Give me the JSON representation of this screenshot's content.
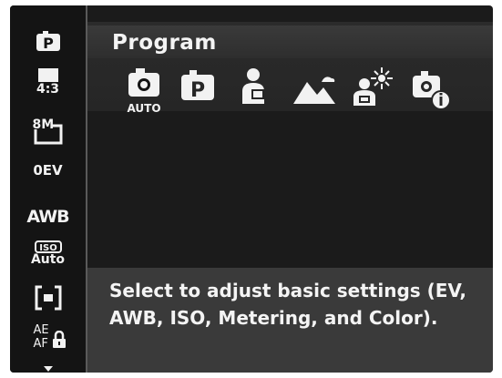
{
  "sidebar": {
    "items": [
      {
        "icon": "program-mode-icon"
      },
      {
        "icon": "aspect-ratio-icon",
        "label": "4:3"
      },
      {
        "icon": "image-size-icon",
        "label": "8M"
      },
      {
        "label": "0EV"
      },
      {
        "label": "AWB"
      },
      {
        "icon": "iso-icon",
        "badge": "ISO",
        "label": "Auto"
      },
      {
        "icon": "metering-icon"
      },
      {
        "icon": "ae-af-lock-icon",
        "label_top": "AE",
        "label_bottom": "AF"
      },
      {
        "icon": "scroll-down-arrow-icon"
      }
    ]
  },
  "menu": {
    "title": "Program",
    "modes": [
      {
        "icon": "auto-mode-icon",
        "label": "AUTO"
      },
      {
        "icon": "program-mode-icon",
        "label": "P"
      },
      {
        "icon": "portrait-mode-icon"
      },
      {
        "icon": "landscape-mode-icon"
      },
      {
        "icon": "backlight-portrait-icon"
      },
      {
        "icon": "scene-info-icon"
      }
    ]
  },
  "description": "Select to adjust basic settings (EV, AWB, ISO, Metering, and Color)."
}
